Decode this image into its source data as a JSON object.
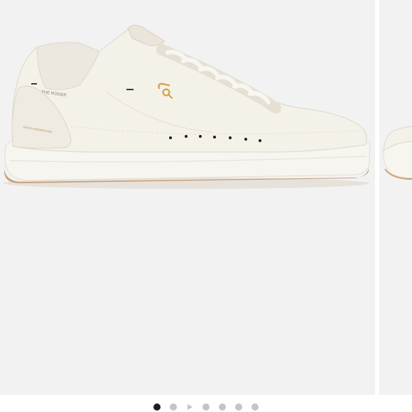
{
  "carousel": {
    "product_image": {
      "icon": "sneaker-image",
      "branding": {
        "model_text": "THE ROGER",
        "heel_text": "SWISS ENGINEERING",
        "logo": "on-logo"
      },
      "colors": {
        "upper": "#f4f1e9",
        "sole": "#f7f5ef",
        "outsole_edge": "#c9a27a",
        "logo_gold": "#d3a24a",
        "eyelets": "#1c1c1c"
      }
    },
    "indicator": {
      "count": 7,
      "active_index": 0,
      "video_index": 2,
      "active_color": "#1f1f1f",
      "inactive_color": "#c4c4c4"
    },
    "background": "#f2f2f2"
  }
}
